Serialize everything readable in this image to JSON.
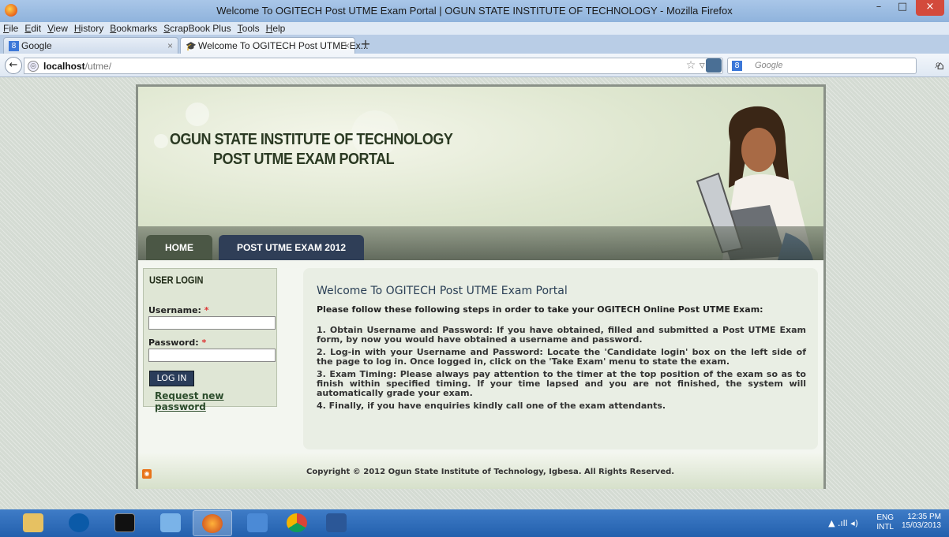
{
  "window": {
    "title": "Welcome To OGITECH Post UTME Exam Portal | OGUN STATE INSTITUTE OF TECHNOLOGY - Mozilla Firefox",
    "min_glyph": "–",
    "max_glyph": "□",
    "close_glyph": "×"
  },
  "menu": [
    "File",
    "Edit",
    "View",
    "History",
    "Bookmarks",
    "ScrapBook Plus",
    "Tools",
    "Help"
  ],
  "tabs": [
    {
      "label": "Google",
      "close": "×"
    },
    {
      "label": "Welcome To OGITECH Post UTME Ex...",
      "close": "×"
    }
  ],
  "newtab_glyph": "+",
  "navbar": {
    "back_glyph": "←",
    "url_host": "localhost",
    "url_path": "/utme/",
    "url_icons": "☆ ▿ C",
    "search_placeholder": "Google",
    "search_glyph": "⌕",
    "home_glyph": "⌂"
  },
  "site": {
    "title_line1": "OGUN STATE INSTITUTE OF TECHNOLOGY",
    "title_line2": "POST UTME EXAM PORTAL",
    "nav": [
      "HOME",
      "POST UTME EXAM 2012"
    ],
    "login": {
      "title": "USER LOGIN",
      "username_label": "Username:",
      "password_label": "Password:",
      "required_mark": "*",
      "button": "LOG IN",
      "request_link": "Request new password"
    },
    "main": {
      "heading": "Welcome To OGITECH Post UTME Exam Portal",
      "intro": "Please follow these following steps in order to take your OGITECH Online Post UTME Exam:",
      "steps": [
        "1. Obtain Username and Password: If you have obtained, filled and submitted a Post UTME Exam form, by now you would have obtained a username and password.",
        "2. Log-in with your Username and Password: Locate the 'Candidate login' box on the left side of the page to log in. Once logged in, click on the 'Take Exam' menu to state the exam.",
        "3. Exam Timing: Please always pay attention to the timer at the top position of the exam so as to finish within specified timing. If your time lapsed and you are not finished, the system will automatically grade your exam.",
        "4. Finally, if you have enquiries kindly call one of the exam attendants."
      ]
    },
    "footer": {
      "copyright": "Copyright © 2012 Ogun State Institute of Technology, Igbesa. All Rights Reserved."
    }
  },
  "taskbar": {
    "lang_line1": "ENG",
    "lang_line2": "INTL",
    "time": "12:35 PM",
    "date": "15/03/2013",
    "tray_icons": "▲ .ıll ◂)"
  },
  "colors": {
    "accent_nav": "#2f3e57",
    "home_tab": "#4b5745",
    "heading": "#2a3f55"
  }
}
